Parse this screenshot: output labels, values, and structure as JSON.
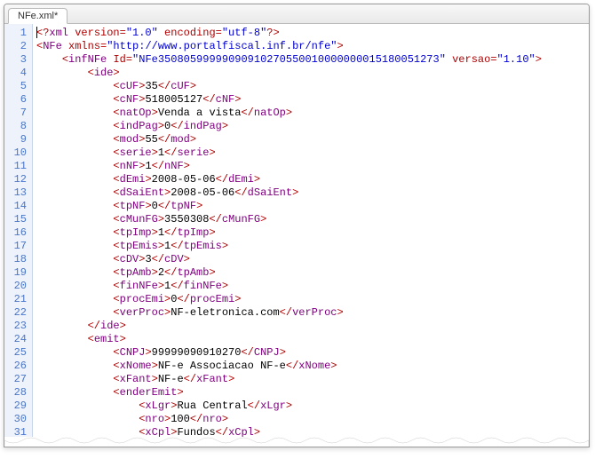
{
  "tab": {
    "title": "NFe.xml*"
  },
  "code": {
    "lines": [
      {
        "n": 1,
        "indent": 0,
        "pre": "<?",
        "tag": "xml",
        "attrs": [
          [
            "version",
            "1.0"
          ],
          [
            "encoding",
            "utf-8"
          ]
        ],
        "post": "?>",
        "cursor": true
      },
      {
        "n": 2,
        "indent": 0,
        "pre": "<",
        "tag": "NFe",
        "attrs": [
          [
            "xmlns",
            "http://www.portalfiscal.inf.br/nfe"
          ]
        ],
        "post": ">"
      },
      {
        "n": 3,
        "indent": 1,
        "pre": "<",
        "tag": "infNFe",
        "attrs": [
          [
            "Id",
            "NFe35080599999090910270550010000000015180051273"
          ],
          [
            "versao",
            "1.10"
          ]
        ],
        "post": ">"
      },
      {
        "n": 4,
        "indent": 2,
        "pre": "<",
        "tag": "ide",
        "post": ">"
      },
      {
        "n": 5,
        "indent": 3,
        "open": "cUF",
        "text": "35"
      },
      {
        "n": 6,
        "indent": 3,
        "open": "cNF",
        "text": "518005127"
      },
      {
        "n": 7,
        "indent": 3,
        "open": "natOp",
        "text": "Venda a vista"
      },
      {
        "n": 8,
        "indent": 3,
        "open": "indPag",
        "text": "0"
      },
      {
        "n": 9,
        "indent": 3,
        "open": "mod",
        "text": "55"
      },
      {
        "n": 10,
        "indent": 3,
        "open": "serie",
        "text": "1"
      },
      {
        "n": 11,
        "indent": 3,
        "open": "nNF",
        "text": "1"
      },
      {
        "n": 12,
        "indent": 3,
        "open": "dEmi",
        "text": "2008-05-06"
      },
      {
        "n": 13,
        "indent": 3,
        "open": "dSaiEnt",
        "text": "2008-05-06"
      },
      {
        "n": 14,
        "indent": 3,
        "open": "tpNF",
        "text": "0"
      },
      {
        "n": 15,
        "indent": 3,
        "open": "cMunFG",
        "text": "3550308"
      },
      {
        "n": 16,
        "indent": 3,
        "open": "tpImp",
        "text": "1"
      },
      {
        "n": 17,
        "indent": 3,
        "open": "tpEmis",
        "text": "1"
      },
      {
        "n": 18,
        "indent": 3,
        "open": "cDV",
        "text": "3"
      },
      {
        "n": 19,
        "indent": 3,
        "open": "tpAmb",
        "text": "2"
      },
      {
        "n": 20,
        "indent": 3,
        "open": "finNFe",
        "text": "1"
      },
      {
        "n": 21,
        "indent": 3,
        "open": "procEmi",
        "text": "0"
      },
      {
        "n": 22,
        "indent": 3,
        "open": "verProc",
        "text": "NF-eletronica.com"
      },
      {
        "n": 23,
        "indent": 2,
        "pre": "</",
        "tag": "ide",
        "post": ">"
      },
      {
        "n": 24,
        "indent": 2,
        "pre": "<",
        "tag": "emit",
        "post": ">"
      },
      {
        "n": 25,
        "indent": 3,
        "open": "CNPJ",
        "text": "99999090910270"
      },
      {
        "n": 26,
        "indent": 3,
        "open": "xNome",
        "text": "NF-e Associacao NF-e"
      },
      {
        "n": 27,
        "indent": 3,
        "open": "xFant",
        "text": "NF-e"
      },
      {
        "n": 28,
        "indent": 3,
        "pre": "<",
        "tag": "enderEmit",
        "post": ">"
      },
      {
        "n": 29,
        "indent": 4,
        "open": "xLgr",
        "text": "Rua Central"
      },
      {
        "n": 30,
        "indent": 4,
        "open": "nro",
        "text": "100"
      },
      {
        "n": 31,
        "indent": 4,
        "open": "xCpl",
        "text": "Fundos"
      }
    ]
  }
}
